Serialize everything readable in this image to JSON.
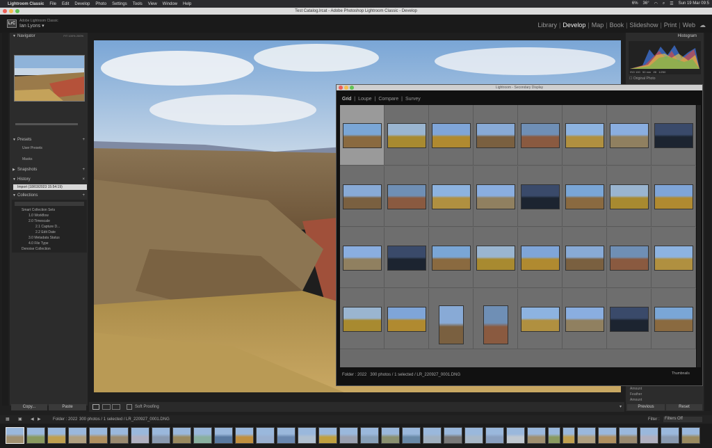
{
  "menubar": {
    "app": "Lightroom Classic",
    "items": [
      "File",
      "Edit",
      "Develop",
      "Photo",
      "Settings",
      "Tools",
      "View",
      "Window",
      "Help"
    ],
    "battery": "6%",
    "temp": "36°",
    "datetime": "Sun 19 Mar 09:5"
  },
  "window": {
    "title": "Test Catalog.lrcat - Adobe Photoshop Lightroom Classic - Develop"
  },
  "identity": {
    "logo": "LrC",
    "subtitle": "Adobe Lightroom Classic",
    "user": "Ian Lyons"
  },
  "modules": [
    "Library",
    "Develop",
    "Map",
    "Book",
    "Slideshow",
    "Print",
    "Web"
  ],
  "left": {
    "navigator": "Navigator",
    "nav_zoom": [
      "FIT",
      "100%",
      "200%"
    ],
    "presets": "Presets",
    "preset_items": [
      "User Presets",
      "Masks"
    ],
    "snapshots": "Snapshots",
    "history": "History",
    "history_item": "Import (18/03/2023 15:54:19)",
    "collections": "Collections",
    "collection_items": [
      "Smart Collection Sets",
      "1.0 Workflow",
      "2.0 Timescale",
      "2.1 Capture D...",
      "2.2 Edit Date",
      "3.0 Metadata Status",
      "4.0 File Type",
      "Denoise Collection"
    ],
    "copy": "Copy...",
    "paste": "Paste"
  },
  "toolbar": {
    "soft_proofing": "Soft Proofing"
  },
  "right": {
    "histogram": "Histogram",
    "original_photo": "Original Photo",
    "previous": "Previous",
    "reset": "Reset",
    "sliders": [
      "Amount",
      "Feather",
      "Amount"
    ]
  },
  "secondary": {
    "title": "Lightroom - Secondary Display",
    "views": [
      "Grid",
      "Loupe",
      "Compare",
      "Survey"
    ],
    "status_folder": "Folder : 2022",
    "status": "300 photos / 1 selected / LR_220927_0001.DNG",
    "thumbnails": "Thumbnails"
  },
  "filmbar": {
    "folder": "Folder : 2022",
    "status": "300 photos / 1 selected / LR_220927_0001.DNG",
    "filter": "Filter :",
    "filter_value": "Filters Off"
  },
  "colors": {
    "accent": "#e7e7e7",
    "panel": "#2c2c2c",
    "grid": "#6b6b6b"
  }
}
